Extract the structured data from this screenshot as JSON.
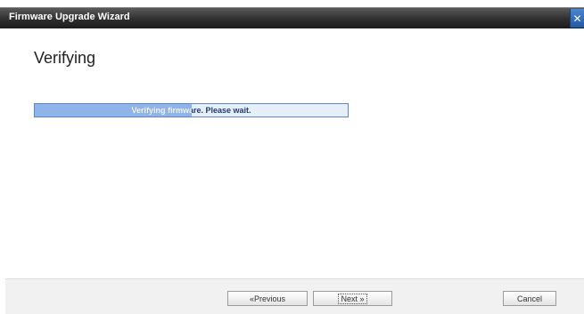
{
  "window": {
    "title": "Firmware Upgrade Wizard",
    "close_glyph": "✕"
  },
  "main": {
    "heading": "Verifying",
    "progress": {
      "message": "Verifying firmware. Please wait.",
      "percent": 50
    }
  },
  "footer": {
    "previous_label": "«Previous",
    "next_label": "Next »",
    "cancel_label": "Cancel"
  },
  "colors": {
    "titlebar": "#2e2e2e",
    "close_button": "#2158a8",
    "progress_fill": "#8eb4ea",
    "progress_track": "#e6eef9"
  }
}
